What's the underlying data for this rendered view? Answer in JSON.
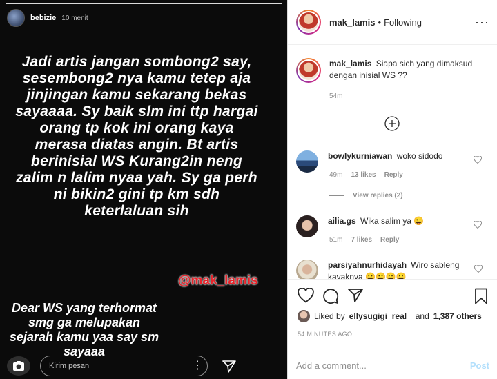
{
  "story": {
    "username": "bebizie",
    "time": "10 menit",
    "text_main": "Jadi artis jangan sombong2 say, sesembong2 nya kamu tetep aja jinjingan kamu sekarang  bekas sayaaaa. Sy baik slm ini ttp hargai orang tp kok ini orang kaya merasa diatas angin. Bt artis berinisial WS Kurang2in neng zalim n lalim nyaa yah. Sy ga perh ni bikin2 gini tp km sdh keterlaluan sih",
    "text_secondary": "Dear WS yang terhormat smg ga melupakan sejarah kamu yaa say sm sayaaa",
    "watermark": "@mak_lamis",
    "reply_placeholder": "Kirim pesan"
  },
  "post": {
    "header": {
      "username": "mak_lamis",
      "separator": "•",
      "follow_status": "Following",
      "more": "···"
    },
    "caption": {
      "username": "mak_lamis",
      "text": "Siapa sich yang dimaksud dengan inisial WS ??",
      "time": "54m"
    },
    "comments": [
      {
        "username": "bowlykurniawan",
        "text": "woko sidodo",
        "time": "49m",
        "likes": "13 likes",
        "reply": "Reply",
        "view_replies": "View replies (2)"
      },
      {
        "username": "ailia.gs",
        "text": "Wika salim ya 😀",
        "time": "51m",
        "likes": "7 likes",
        "reply": "Reply"
      },
      {
        "username": "parsiyahnurhidayah",
        "text": "Wiro sableng kayaknya 😀😀😀😀"
      }
    ],
    "liked_by": {
      "prefix": "Liked by",
      "user": "ellysugigi_real_",
      "mid": "and",
      "others": "1,387 others"
    },
    "age": "54 MINUTES AGO",
    "add_comment_placeholder": "Add a comment...",
    "post_label": "Post"
  },
  "colors": {
    "watermark": "#e8232a",
    "link_blue_disabled": "#b2dffc",
    "muted": "#8e8e8e"
  }
}
